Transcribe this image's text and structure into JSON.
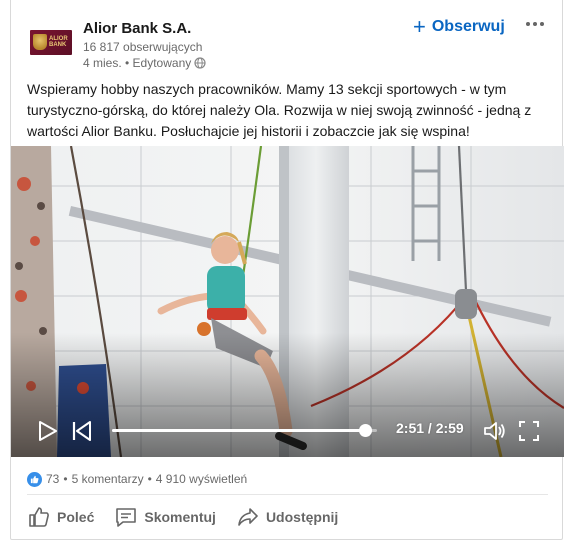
{
  "company": {
    "logo_text": "ALIOR BANK",
    "name": "Alior Bank S.A.",
    "followers": "16 817 obserwujących",
    "time_ago": "4 mies. • Edytowany"
  },
  "follow": {
    "plus": "+",
    "label": "Obserwuj"
  },
  "post": {
    "text": "Wspieramy hobby naszych pracowników. Mamy 13 sekcji sportowych - w tym turystyczno-górską, do której należy Ola. Rozwija w niej swoją zwinność - jedną z wartości Alior Banku. Posłuchajcie jej historii i zobaczcie jak się wspina!"
  },
  "video": {
    "current_time": "2:51",
    "duration": "2:59",
    "time_display": "2:51 / 2:59",
    "progress": 0.955
  },
  "social": {
    "likes": "73",
    "separator": "•",
    "comments": "5 komentarzy",
    "views": "4 910 wyświetleń"
  },
  "actions": {
    "like": "Poleć",
    "comment": "Skomentuj",
    "share": "Udostępnij"
  },
  "colors": {
    "accent": "#0a66c2",
    "like_badge": "#378fe9",
    "brand": "#7a1530"
  },
  "icons": {
    "globe": "globe-icon",
    "more": "ellipsis-icon",
    "play": "play-icon",
    "rewind": "skip-back-icon",
    "volume": "volume-icon",
    "fullscreen": "fullscreen-icon",
    "like": "thumbs-up-icon",
    "comment": "comment-icon",
    "share": "share-icon"
  }
}
